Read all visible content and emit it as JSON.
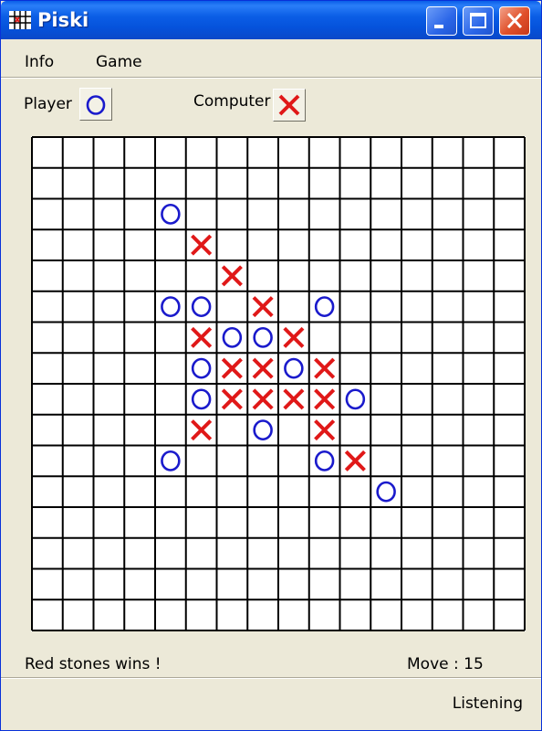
{
  "window": {
    "title": "Piski"
  },
  "menu": {
    "items": [
      {
        "label": "Info"
      },
      {
        "label": "Game"
      }
    ]
  },
  "players": {
    "player_label": "Player",
    "player_symbol": "O",
    "computer_label": "Computer",
    "computer_symbol": "X"
  },
  "colors": {
    "o_color": "#1a1acc",
    "x_color": "#e01818",
    "grid_color": "#000000"
  },
  "board": {
    "columns": 16,
    "rows": 16,
    "stones": [
      {
        "col": 4,
        "row": 2,
        "symbol": "O"
      },
      {
        "col": 5,
        "row": 3,
        "symbol": "X"
      },
      {
        "col": 6,
        "row": 4,
        "symbol": "X"
      },
      {
        "col": 4,
        "row": 5,
        "symbol": "O"
      },
      {
        "col": 5,
        "row": 5,
        "symbol": "O"
      },
      {
        "col": 7,
        "row": 5,
        "symbol": "X"
      },
      {
        "col": 9,
        "row": 5,
        "symbol": "O"
      },
      {
        "col": 5,
        "row": 6,
        "symbol": "X"
      },
      {
        "col": 6,
        "row": 6,
        "symbol": "O"
      },
      {
        "col": 7,
        "row": 6,
        "symbol": "O"
      },
      {
        "col": 8,
        "row": 6,
        "symbol": "X"
      },
      {
        "col": 5,
        "row": 7,
        "symbol": "O"
      },
      {
        "col": 6,
        "row": 7,
        "symbol": "X"
      },
      {
        "col": 7,
        "row": 7,
        "symbol": "X"
      },
      {
        "col": 8,
        "row": 7,
        "symbol": "O"
      },
      {
        "col": 9,
        "row": 7,
        "symbol": "X"
      },
      {
        "col": 5,
        "row": 8,
        "symbol": "O"
      },
      {
        "col": 6,
        "row": 8,
        "symbol": "X"
      },
      {
        "col": 7,
        "row": 8,
        "symbol": "X"
      },
      {
        "col": 8,
        "row": 8,
        "symbol": "X"
      },
      {
        "col": 9,
        "row": 8,
        "symbol": "X"
      },
      {
        "col": 10,
        "row": 8,
        "symbol": "O"
      },
      {
        "col": 5,
        "row": 9,
        "symbol": "X"
      },
      {
        "col": 7,
        "row": 9,
        "symbol": "O"
      },
      {
        "col": 9,
        "row": 9,
        "symbol": "X"
      },
      {
        "col": 4,
        "row": 10,
        "symbol": "O"
      },
      {
        "col": 9,
        "row": 10,
        "symbol": "O"
      },
      {
        "col": 10,
        "row": 10,
        "symbol": "X"
      },
      {
        "col": 11,
        "row": 11,
        "symbol": "O"
      }
    ]
  },
  "status": {
    "message": "Red stones wins !",
    "move_text": "Move : 15",
    "network": "Listening"
  }
}
